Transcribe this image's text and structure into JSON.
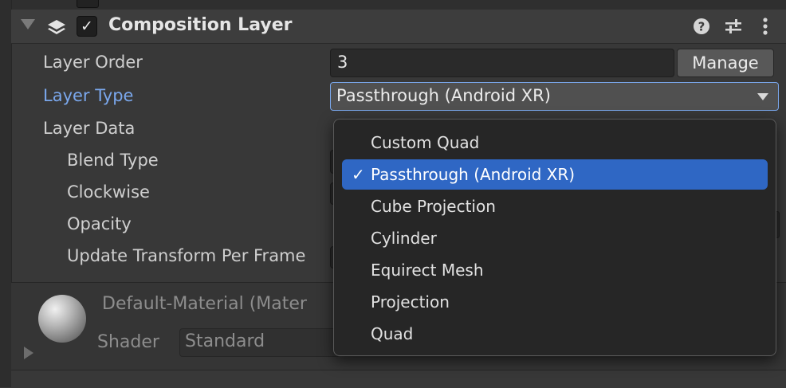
{
  "component": {
    "title": "Composition Layer",
    "enabled_check": "✓"
  },
  "fields": {
    "layer_order_label": "Layer Order",
    "layer_order_value": "3",
    "manage_label": "Manage",
    "layer_type_label": "Layer Type",
    "layer_type_value": "Passthrough (Android XR)",
    "layer_data_label": "Layer Data",
    "blend_type_label": "Blend Type",
    "clockwise_label": "Clockwise",
    "opacity_label": "Opacity",
    "update_transform_label": "Update Transform Per Frame"
  },
  "material": {
    "name": "Default-Material (Mater",
    "shader_label": "Shader",
    "shader_value": "Standard"
  },
  "dropdown_menu": {
    "selected_check": "✓",
    "items": [
      {
        "label": "Custom Quad"
      },
      {
        "label": "Passthrough (Android XR)"
      },
      {
        "label": "Cube Projection"
      },
      {
        "label": "Cylinder"
      },
      {
        "label": "Equirect Mesh"
      },
      {
        "label": "Projection"
      },
      {
        "label": "Quad"
      }
    ],
    "selected_index": 1
  },
  "colors": {
    "accent": "#2f67c4",
    "active_label": "#7aa7ec"
  },
  "icons": [
    "layers-icon",
    "help-icon",
    "preset-sliders-icon",
    "kebab-menu-icon",
    "foldout-arrow-icon"
  ]
}
